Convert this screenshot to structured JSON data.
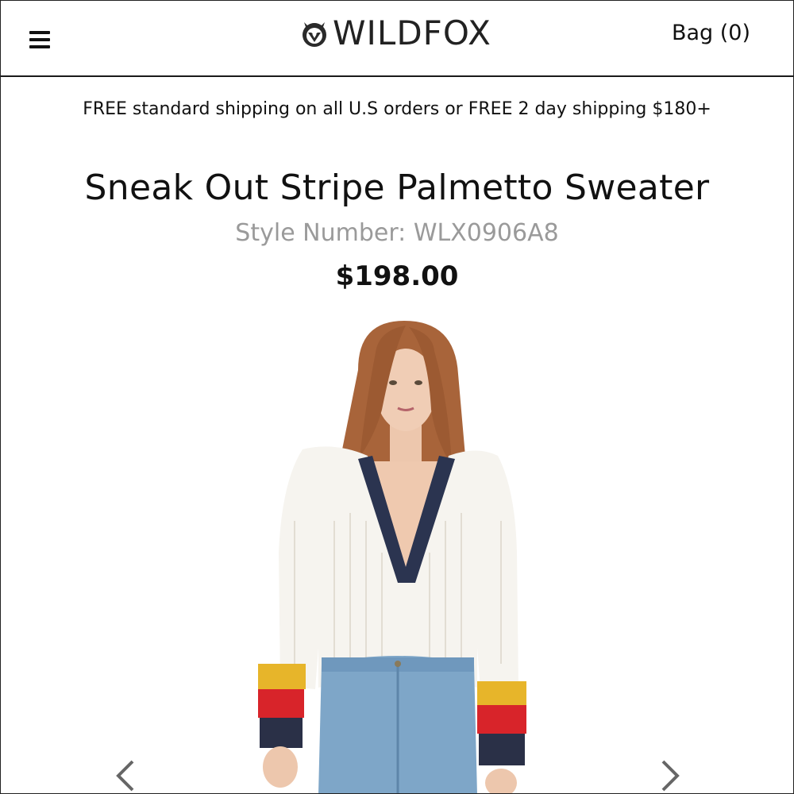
{
  "header": {
    "brand": "WILDFOX",
    "bag_label": "Bag (0)"
  },
  "banner": {
    "shipping_text": "FREE standard shipping on all U.S orders or FREE 2 day shipping $180+"
  },
  "product": {
    "title": "Sneak Out Stripe Palmetto Sweater",
    "style_number": "Style Number: WLX0906A8",
    "price": "$198.00"
  },
  "icons": {
    "menu": "hamburger-menu-icon",
    "logo": "fox-logo-icon",
    "prev": "chevron-left-icon",
    "next": "chevron-right-icon"
  },
  "colors": {
    "text": "#111111",
    "muted": "#9a9a9a",
    "divider": "#1a1a1a",
    "background": "#ffffff"
  }
}
